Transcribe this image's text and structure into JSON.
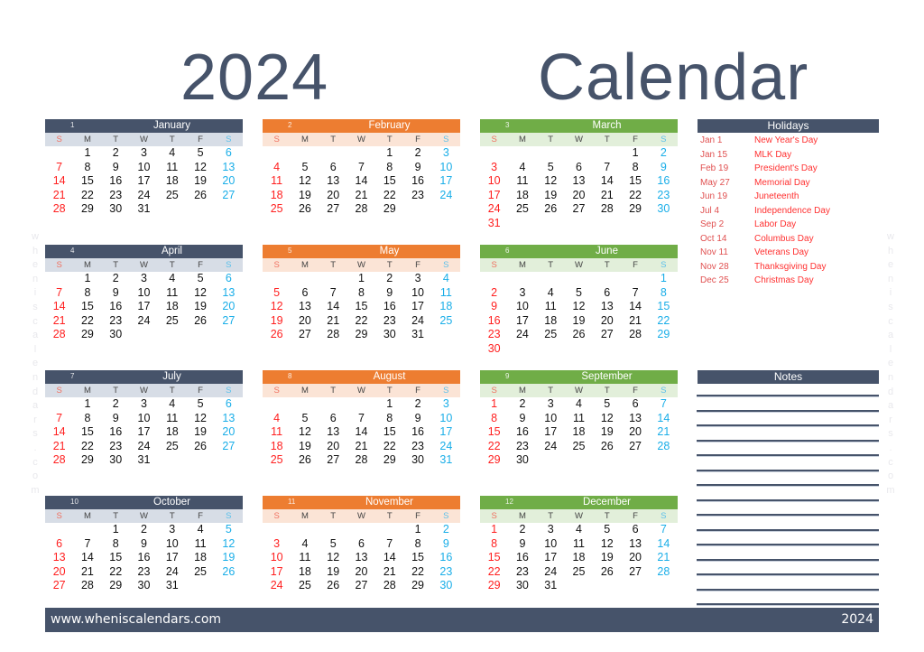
{
  "header": {
    "year": "2024",
    "title": "Calendar"
  },
  "weekdays": [
    "S",
    "M",
    "T",
    "W",
    "T",
    "F",
    "S"
  ],
  "watermark": [
    "w",
    "h",
    "e",
    "n",
    "i",
    "s",
    "c",
    "a",
    "l",
    "e",
    "n",
    "d",
    "a",
    "r",
    "s",
    ".",
    "c",
    "o",
    "m"
  ],
  "months": [
    {
      "num": "1",
      "name": "January",
      "start": 1,
      "days": 31,
      "theme": "blue"
    },
    {
      "num": "2",
      "name": "February",
      "start": 4,
      "days": 29,
      "theme": "orange"
    },
    {
      "num": "3",
      "name": "March",
      "start": 5,
      "days": 31,
      "theme": "green"
    },
    {
      "num": "4",
      "name": "April",
      "start": 1,
      "days": 30,
      "theme": "blue"
    },
    {
      "num": "5",
      "name": "May",
      "start": 3,
      "days": 31,
      "theme": "orange"
    },
    {
      "num": "6",
      "name": "June",
      "start": 6,
      "days": 30,
      "theme": "green"
    },
    {
      "num": "7",
      "name": "July",
      "start": 1,
      "days": 31,
      "theme": "blue"
    },
    {
      "num": "8",
      "name": "August",
      "start": 4,
      "days": 31,
      "theme": "orange"
    },
    {
      "num": "9",
      "name": "September",
      "start": 0,
      "days": 30,
      "theme": "green"
    },
    {
      "num": "10",
      "name": "October",
      "start": 2,
      "days": 31,
      "theme": "blue"
    },
    {
      "num": "11",
      "name": "November",
      "start": 5,
      "days": 30,
      "theme": "orange"
    },
    {
      "num": "12",
      "name": "December",
      "start": 0,
      "days": 31,
      "theme": "green"
    }
  ],
  "holidays": {
    "title": "Holidays",
    "items": [
      {
        "date": "Jan 1",
        "name": "New Year's Day"
      },
      {
        "date": "Jan 15",
        "name": "MLK Day"
      },
      {
        "date": "Feb 19",
        "name": "President's Day"
      },
      {
        "date": "May 27",
        "name": "Memorial Day"
      },
      {
        "date": "Jun 19",
        "name": "Juneteenth"
      },
      {
        "date": "Jul 4",
        "name": "Independence Day"
      },
      {
        "date": "Sep 2",
        "name": "Labor Day"
      },
      {
        "date": "Oct 14",
        "name": "Columbus Day"
      },
      {
        "date": "Nov 11",
        "name": "Veterans Day"
      },
      {
        "date": "Nov 28",
        "name": "Thanksgiving Day"
      },
      {
        "date": "Dec 25",
        "name": "Christmas Day"
      }
    ]
  },
  "notes": {
    "title": "Notes",
    "line_count": 15
  },
  "footer": {
    "url": "www.wheniscalendars.com",
    "year": "2024"
  }
}
